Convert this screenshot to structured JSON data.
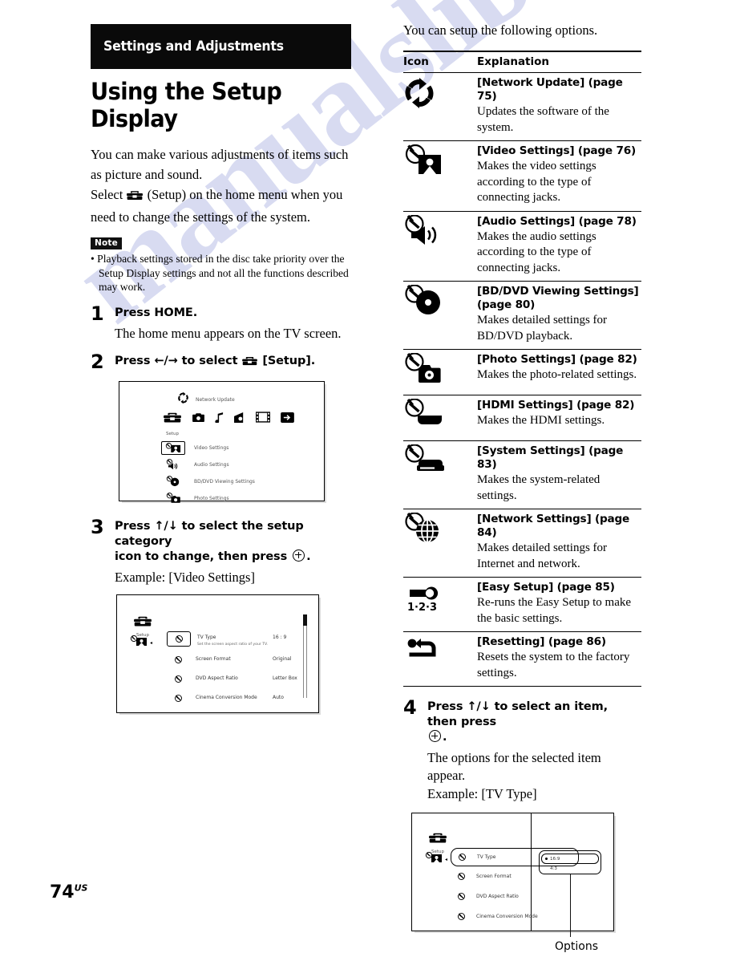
{
  "watermark": "manualslib",
  "folio": {
    "number": "74",
    "suffix": "US"
  },
  "left": {
    "band_title": "Settings and Adjustments",
    "heading": "Using the Setup Display",
    "intro_line1": "You can make various adjustments of items such",
    "intro_line2": "as picture and sound.",
    "intro_select_prefix": "Select",
    "intro_select_suffix": "(Setup) on the home menu when you",
    "intro_line4": "need to change the settings of the system.",
    "note_tag": "Note",
    "note_text": "• Playback settings stored in the disc take priority over the Setup Display settings and not all the functions described may work.",
    "steps": [
      {
        "num": "1",
        "head": "Press HOME.",
        "sub": "The home menu appears on the TV screen."
      },
      {
        "num": "2",
        "head_pre": "Press ←/→ to select",
        "head_post": "[Setup].",
        "sub": ""
      },
      {
        "num": "3",
        "head_line1": "Press ↑/↓ to select the setup category",
        "head_line2_pre": "icon to change, then press",
        "head_line2_post": ".",
        "sub": "Example: [Video Settings]"
      }
    ],
    "shot_home": {
      "top_item": "Network Update",
      "setup_label": "Setup",
      "xmb_icons": [
        "setup-toolbox-icon",
        "photo-camera-icon",
        "music-note-icon",
        "radio-icon",
        "video-film-icon",
        "input-icon"
      ],
      "items": [
        {
          "label": "Video Settings",
          "selected": true
        },
        {
          "label": "Audio Settings",
          "selected": false
        },
        {
          "label": "BD/DVD Viewing Settings",
          "selected": false
        },
        {
          "label": "Photo Settings",
          "selected": false
        }
      ]
    },
    "shot_video": {
      "setup_label": "Setup",
      "rows": [
        {
          "name": "TV Type",
          "sub": "Set the screen aspect ratio of your TV.",
          "value": "16 : 9",
          "selected": true
        },
        {
          "name": "Screen Format",
          "sub": "",
          "value": "Original",
          "selected": false
        },
        {
          "name": "DVD Aspect Ratio",
          "sub": "",
          "value": "Letter Box",
          "selected": false
        },
        {
          "name": "Cinema Conversion Mode",
          "sub": "",
          "value": "Auto",
          "selected": false
        }
      ]
    }
  },
  "right": {
    "lead_in": "You can setup the following options.",
    "table": {
      "headers": [
        "Icon",
        "Explanation"
      ],
      "rows": [
        {
          "icon": "network-update-icon",
          "title": "[Network Update] (page 75)",
          "desc": "Updates the software of the system."
        },
        {
          "icon": "video-settings-icon",
          "title": "[Video Settings] (page 76)",
          "desc": "Makes the video settings according to the type of connecting jacks."
        },
        {
          "icon": "audio-settings-icon",
          "title": "[Audio Settings] (page 78)",
          "desc": "Makes the audio settings according to the type of connecting jacks."
        },
        {
          "icon": "bd-dvd-viewing-settings-icon",
          "title": "[BD/DVD Viewing Settings] (page 80)",
          "desc": "Makes detailed settings for BD/DVD playback."
        },
        {
          "icon": "photo-settings-icon",
          "title": "[Photo Settings] (page 82)",
          "desc": "Makes the photo-related settings."
        },
        {
          "icon": "hdmi-settings-icon",
          "title": "[HDMI Settings] (page 82)",
          "desc": "Makes the HDMI settings."
        },
        {
          "icon": "system-settings-icon",
          "title": "[System Settings] (page 83)",
          "desc": "Makes the system-related settings."
        },
        {
          "icon": "network-settings-icon",
          "title": "[Network Settings] (page 84)",
          "desc": "Makes detailed settings for Internet and network."
        },
        {
          "icon": "easy-setup-icon",
          "title": "[Easy Setup] (page 85)",
          "desc": "Re-runs the Easy Setup to make the basic settings."
        },
        {
          "icon": "resetting-icon",
          "title": "[Resetting] (page 86)",
          "desc": "Resets the system to the factory settings."
        }
      ]
    },
    "step4": {
      "num": "4",
      "head_line1": "Press ↑/↓ to select an item, then press",
      "head_line2_post": ".",
      "sub1": "The options for the selected item appear.",
      "sub2": "Example: [TV Type]"
    },
    "shot_tvtype": {
      "setup_label": "Setup",
      "rows": [
        {
          "name": "TV Type",
          "selected": true
        },
        {
          "name": "Screen Format",
          "selected": false
        },
        {
          "name": "DVD Aspect Ratio",
          "selected": false
        },
        {
          "name": "Cinema Conversion Mode",
          "selected": false
        }
      ],
      "options": [
        {
          "label": "16:9",
          "selected": true
        },
        {
          "label": "4:3",
          "selected": false
        }
      ],
      "callout": "Options"
    }
  }
}
